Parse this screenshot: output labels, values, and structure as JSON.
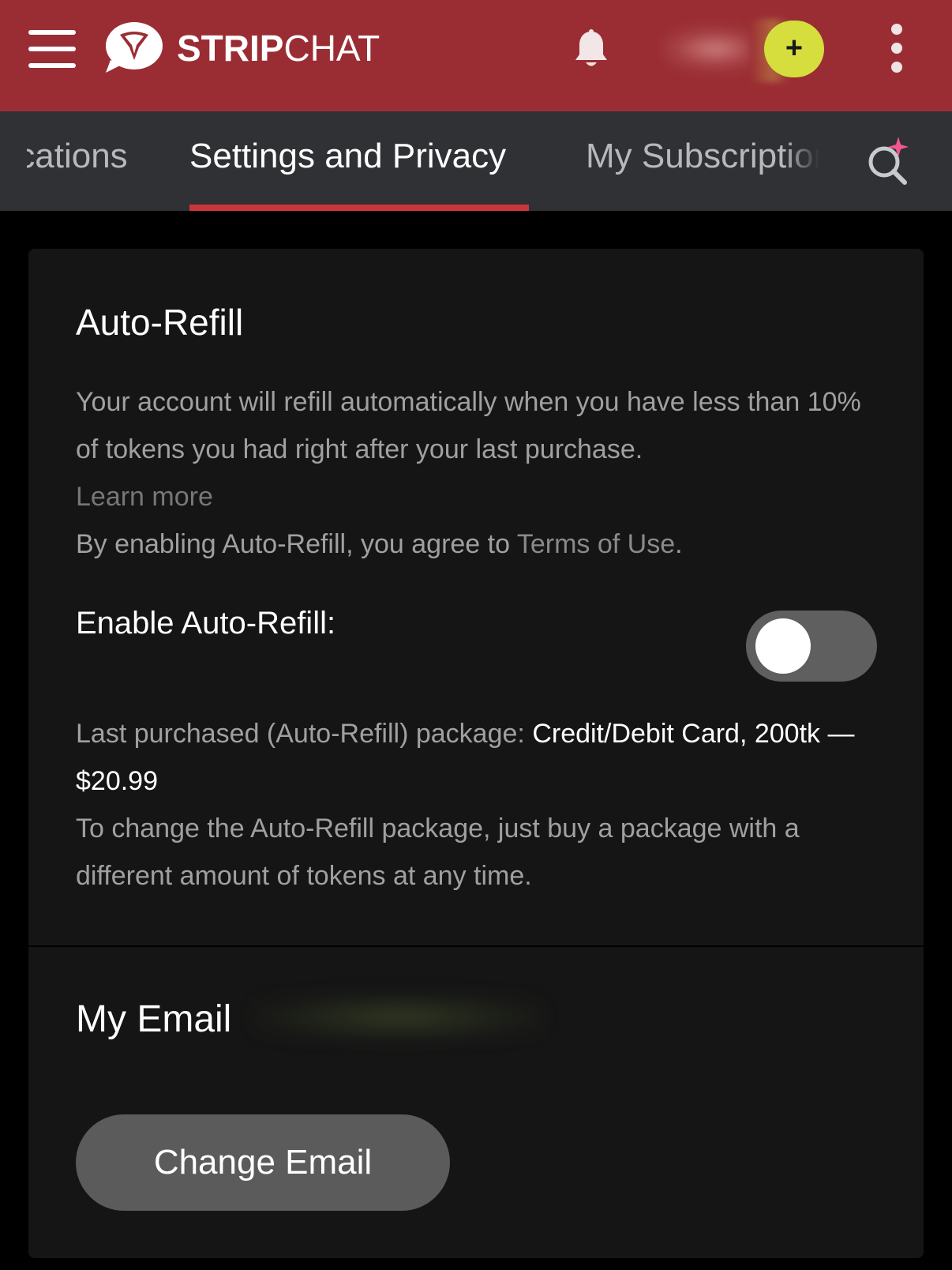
{
  "header": {
    "brand_bold": "STRIP",
    "brand_light": "CHAT",
    "add_label": "+",
    "colors": {
      "bar": "#9a2d33",
      "add_button": "#d5de3d"
    },
    "icons": [
      "hamburger-icon",
      "stripchat-logo-icon",
      "bell-icon",
      "plus-icon",
      "kebab-menu-icon"
    ]
  },
  "tabs": {
    "items": [
      {
        "label": "Notifications"
      },
      {
        "label": "Settings and Privacy",
        "active": true
      },
      {
        "label": "My Subscriptions"
      }
    ],
    "search_icon": "ai-search-icon",
    "accent": "#c8363b"
  },
  "auto_refill": {
    "title": "Auto-Refill",
    "description": "Your account will refill automatically when you have less than 10% of tokens you had right after your last purchase.",
    "learn_more": "Learn more",
    "agree_prefix": "By enabling Auto-Refill, you agree to ",
    "terms_link": "Terms of Use",
    "agree_suffix": ".",
    "enable_label": "Enable Auto-Refill:",
    "enabled": false,
    "last_purchase_label": "Last purchased (Auto-Refill) package: ",
    "last_purchase_value": "Credit/Debit Card, 200tk — $20.99",
    "change_note": "To change the Auto-Refill package, just buy a package with a different amount of tokens at any time."
  },
  "email": {
    "title": "My Email",
    "change_button": "Change Email"
  }
}
